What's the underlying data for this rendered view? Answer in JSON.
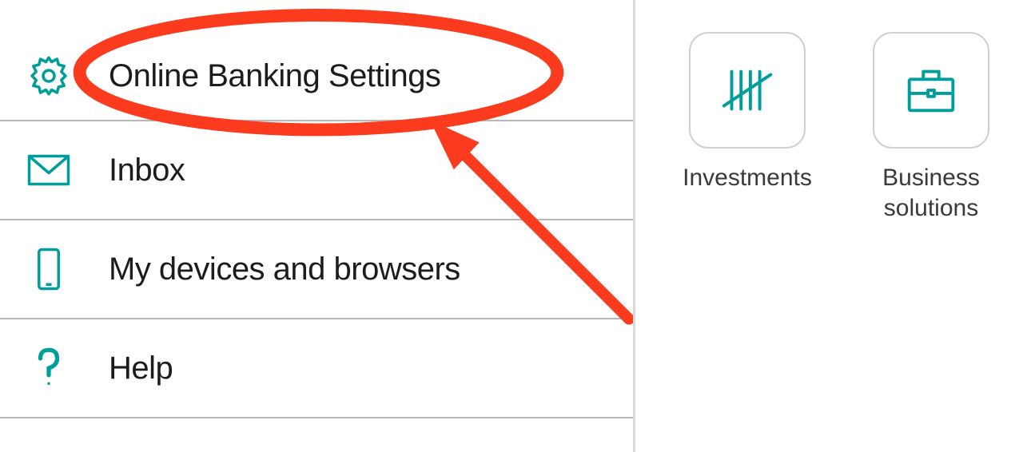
{
  "sidebar": {
    "items": [
      {
        "label": "Online Banking Settings",
        "icon": "gear-icon"
      },
      {
        "label": "Inbox",
        "icon": "envelope-icon"
      },
      {
        "label": "My devices and browsers",
        "icon": "phone-icon"
      },
      {
        "label": "Help",
        "icon": "question-icon"
      }
    ]
  },
  "tiles": [
    {
      "label": "Investments",
      "icon": "tally-icon"
    },
    {
      "label": "Business solutions",
      "icon": "briefcase-icon"
    }
  ],
  "annotation": {
    "type": "highlight",
    "target": "sidebar-item-online-banking-settings",
    "color": "#fa3b1d"
  },
  "theme": {
    "accent": "#009e9a",
    "annotation_red": "#fa3b1d"
  }
}
